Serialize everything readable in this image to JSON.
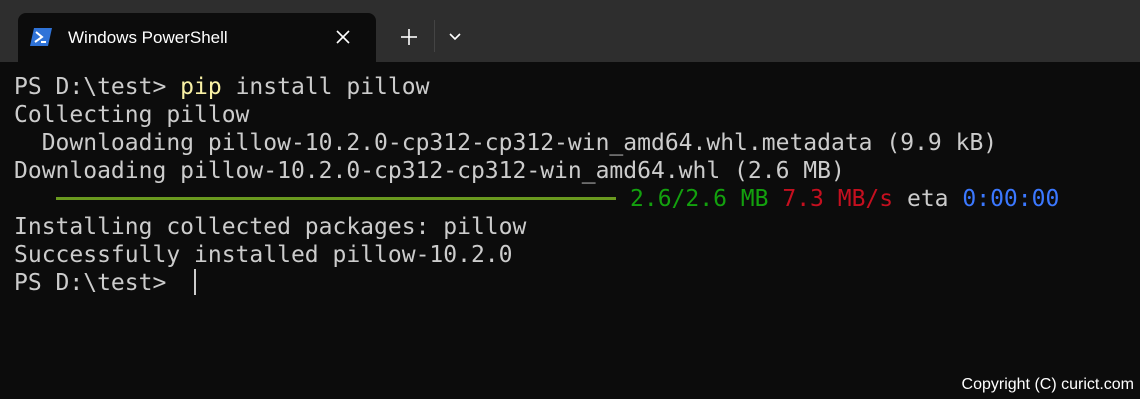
{
  "window": {
    "tab_title": "Windows PowerShell"
  },
  "terminal": {
    "prompt1": "PS D:\\test> ",
    "cmd_pip": "pip",
    "cmd_rest": " install pillow",
    "line_collecting": "Collecting pillow",
    "line_dl_meta": "  Downloading pillow-10.2.0-cp312-cp312-win_amd64.whl.metadata (9.9 kB)",
    "line_dl_whl": "Downloading pillow-10.2.0-cp312-cp312-win_amd64.whl (2.6 MB)",
    "progress": {
      "fraction": 1.0,
      "size": "2.6/2.6 MB",
      "speed": "7.3 MB/s",
      "eta_label": "eta",
      "eta": "0:00:00"
    },
    "line_installing": "Installing collected packages: pillow",
    "line_success": "Successfully installed pillow-10.2.0",
    "prompt2": "PS D:\\test> "
  },
  "footer": {
    "copyright": "Copyright (C) curict.com"
  },
  "colors": {
    "background": "#0c0c0c",
    "titlebar": "#2e2e2e",
    "command": "#f9f1a5",
    "progress_bar": "#6a9a1f",
    "size": "#13a10e",
    "speed": "#c50f1f",
    "eta": "#3b78ff"
  },
  "icons": {
    "tab": "powershell-icon",
    "close": "close-icon",
    "new_tab": "plus-icon",
    "dropdown": "chevron-down-icon"
  }
}
